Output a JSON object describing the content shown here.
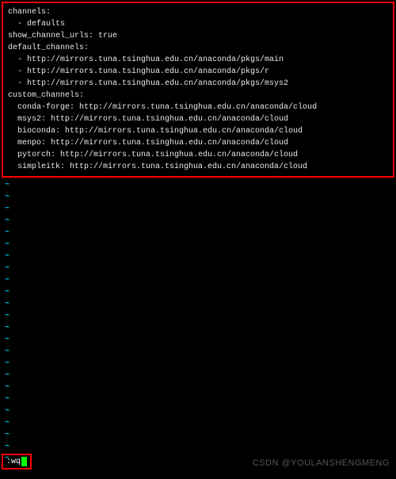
{
  "config": {
    "lines": [
      "channels:",
      "  - defaults",
      "show_channel_urls: true",
      "default_channels:",
      "  - http://mirrors.tuna.tsinghua.edu.cn/anaconda/pkgs/main",
      "  - http://mirrors.tuna.tsinghua.edu.cn/anaconda/pkgs/r",
      "  - http://mirrors.tuna.tsinghua.edu.cn/anaconda/pkgs/msys2",
      "custom_channels:",
      "  conda-forge: http://mirrors.tuna.tsinghua.edu.cn/anaconda/cloud",
      "  msys2: http://mirrors.tuna.tsinghua.edu.cn/anaconda/cloud",
      "  bioconda: http://mirrors.tuna.tsinghua.edu.cn/anaconda/cloud",
      "  menpo: http://mirrors.tuna.tsinghua.edu.cn/anaconda/cloud",
      "  pytorch: http://mirrors.tuna.tsinghua.edu.cn/anaconda/cloud",
      "  simpleitk: http://mirrors.tuna.tsinghua.edu.cn/anaconda/cloud"
    ]
  },
  "tilde": "~",
  "tilde_count": 24,
  "command": ":wq",
  "watermark": "CSDN @YOULANSHENGMENG"
}
